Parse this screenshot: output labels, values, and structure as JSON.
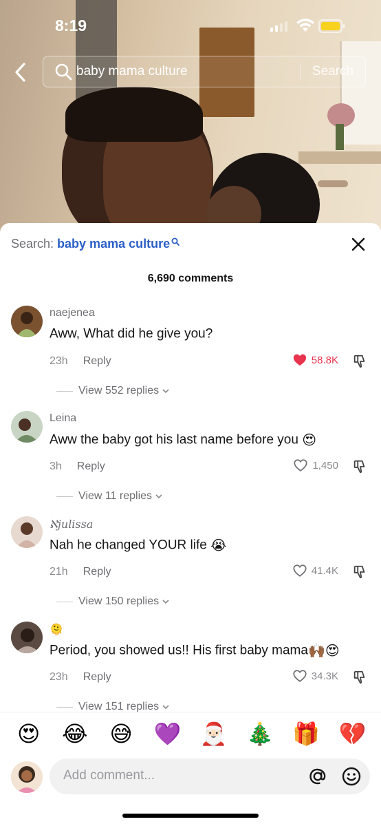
{
  "status": {
    "time": "8:19"
  },
  "search": {
    "query": "baby mama culture",
    "button": "Search"
  },
  "sheet": {
    "search_prefix": "Search: ",
    "search_term": "baby mama culture",
    "count_label": "6,690 comments"
  },
  "comments": [
    {
      "user": "naejenea",
      "text": "Aww, What did he give you?",
      "time": "23h",
      "reply": "Reply",
      "likes": "58.8K",
      "liked": true,
      "replies": "View 552 replies",
      "emoji": ""
    },
    {
      "user": "Leina",
      "text": "Aww the baby got his last name before you ",
      "time": "3h",
      "reply": "Reply",
      "likes": "1,450",
      "liked": false,
      "replies": "View 11 replies",
      "emoji": "😍"
    },
    {
      "user": "ℵjulissa",
      "text": "Nah he changed YOUR life ",
      "time": "21h",
      "reply": "Reply",
      "likes": "41.4K",
      "liked": false,
      "replies": "View 150 replies",
      "emoji": "😭"
    },
    {
      "user": "🫠",
      "text": "Period, you showed us!! His first baby mama",
      "time": "23h",
      "reply": "Reply",
      "likes": "34.3K",
      "liked": false,
      "replies": "View 151 replies",
      "emoji": "🙌🏾😍"
    }
  ],
  "emoji_bar": [
    "😍",
    "😂",
    "😅",
    "💜",
    "🎅🏻",
    "🎄",
    "🎁",
    "💔"
  ],
  "composer": {
    "placeholder": "Add comment..."
  },
  "colors": {
    "accent_link": "#2b5fc7",
    "like_red": "#e8344e"
  }
}
